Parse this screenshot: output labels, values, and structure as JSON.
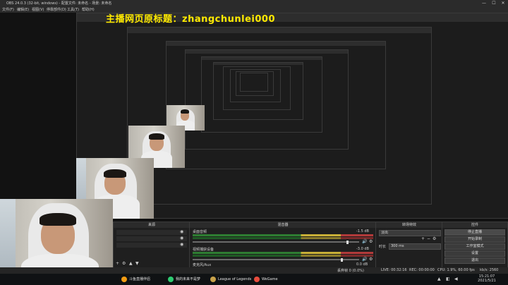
{
  "window": {
    "title": "OBS 24.0.3 (32-bit, windows) - 配置文件: 未命名 - 场景: 未命名",
    "controls": [
      "—",
      "☐",
      "✕"
    ]
  },
  "overlay": {
    "text": "主播网页原标题：zhangchunlei000"
  },
  "menu": {
    "items": [
      "文件(F)",
      "编辑(E)",
      "视图(V)",
      "停靠部件(D)",
      "工具(T)",
      "帮助(H)"
    ]
  },
  "sources_panel": {
    "title": "来源",
    "items": [
      "",
      "",
      ""
    ]
  },
  "mixer_panel": {
    "title": "混音器",
    "channels": [
      {
        "name": "桌面音频",
        "db": "-1.5 dB"
      },
      {
        "name": "麦克风/Aux",
        "db": "0.0 dB"
      },
      {
        "name": "视频捕获设备",
        "db": "-3.0 dB"
      }
    ]
  },
  "transitions_panel": {
    "title": "转场特效",
    "selected": "淡出",
    "duration_label": "时长",
    "duration_value": "300 ms"
  },
  "controls_panel": {
    "title": "控件",
    "buttons": [
      "停止直播",
      "开始录制",
      "工作室模式",
      "设置",
      "退出"
    ]
  },
  "status": {
    "dropped": "丢弃帧 0 (0.0%)",
    "live": "LIVE: 00:32:16",
    "rec": "REC: 00:00:00",
    "cpu": "CPU: 1.9%, 60.00 fps",
    "bitrate": "kb/s: 2560"
  },
  "taskbar": {
    "items": [
      {
        "label": "斗鱼直播伴侣",
        "color": "#f39c12"
      },
      {
        "label": "我的未来不是梦",
        "color": "#2ecc71"
      },
      {
        "label": "League of Legends",
        "color": "#c9a24a"
      },
      {
        "label": "WeGame",
        "color": "#e84c3d"
      }
    ],
    "time": "15:21:07",
    "date": "2021/5/21"
  }
}
